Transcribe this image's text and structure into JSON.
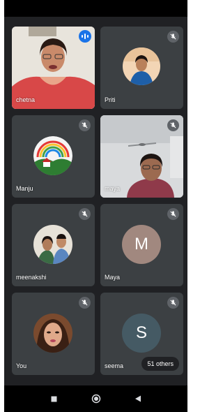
{
  "participants": [
    {
      "name": "chetna",
      "mic": "speaking",
      "type": "video"
    },
    {
      "name": "Priti",
      "mic": "muted",
      "type": "photo-avatar"
    },
    {
      "name": "Manju",
      "mic": "muted",
      "type": "logo-avatar"
    },
    {
      "name": "maya",
      "mic": "muted",
      "type": "video"
    },
    {
      "name": "meenakshi",
      "mic": "muted",
      "type": "photo-avatar"
    },
    {
      "name": "Maya",
      "mic": "muted",
      "type": "letter-avatar",
      "initial": "M",
      "avatar_color": "#a1887f"
    },
    {
      "name": "You",
      "mic": "muted",
      "type": "photo-avatar"
    },
    {
      "name": "seema",
      "mic": "muted",
      "type": "letter-avatar",
      "initial": "S",
      "avatar_color": "#455a64"
    }
  ],
  "others_chip": "51 others",
  "nav_icons": [
    "recents-square-icon",
    "home-circle-icon",
    "back-triangle-icon"
  ],
  "colors": {
    "tile": "#3c4043",
    "background": "#202124",
    "speaking": "#1a73e8"
  }
}
